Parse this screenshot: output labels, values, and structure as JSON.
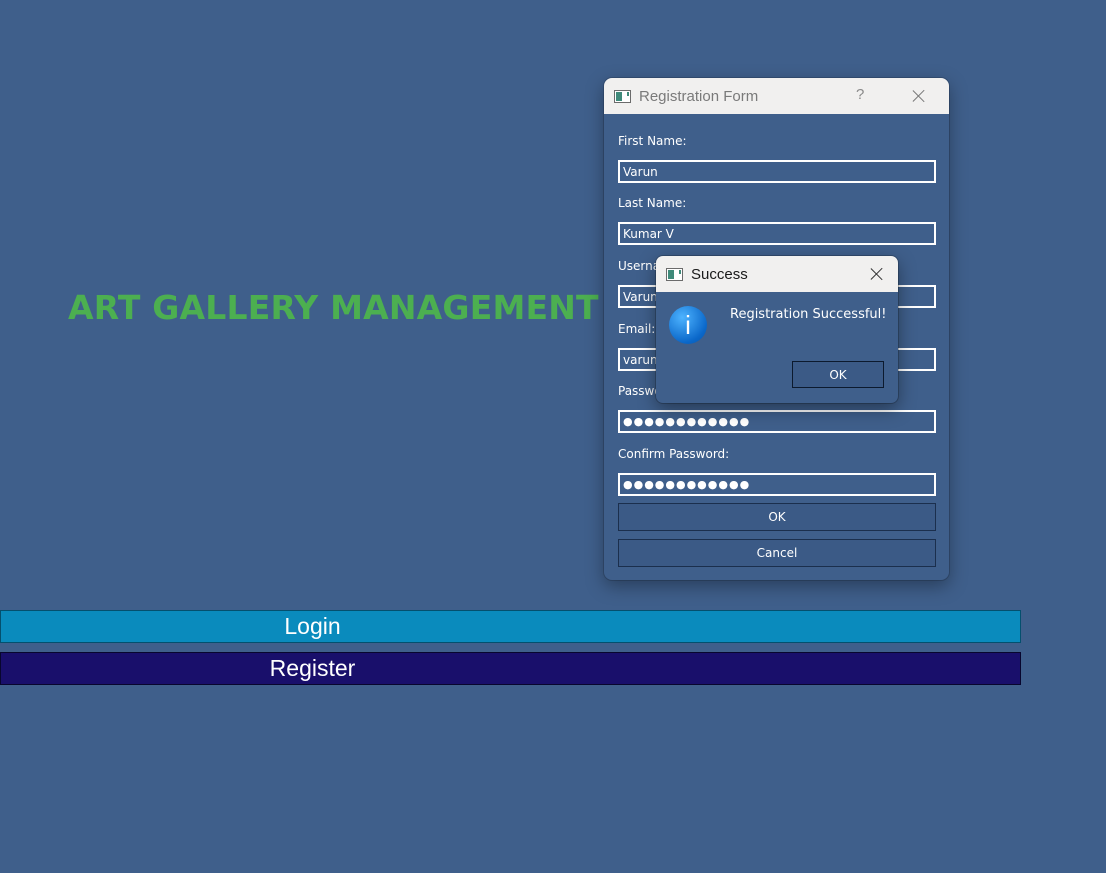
{
  "app": {
    "title": "ART GALLERY MANAGEMENT",
    "login_label": "Login",
    "register_label": "Register"
  },
  "registration_dialog": {
    "title": "Registration Form",
    "help_label": "?",
    "fields": [
      {
        "label": "First Name:",
        "value": "Varun"
      },
      {
        "label": "Last Name:",
        "value": "Kumar V"
      },
      {
        "label": "Username:",
        "value": "Varun"
      },
      {
        "label": "Email:",
        "value": "varunk"
      },
      {
        "label": "Password:",
        "value": "●●●●●●●●●●●●"
      },
      {
        "label": "Confirm Password:",
        "value": "●●●●●●●●●●●●"
      }
    ],
    "ok_label": "OK",
    "cancel_label": "Cancel"
  },
  "success_dialog": {
    "title": "Success",
    "icon": "info-icon",
    "icon_glyph": "i",
    "message": "Registration Successful!",
    "ok_label": "OK"
  },
  "colors": {
    "background": "#3f5f8b",
    "title_green": "#4caf50",
    "login_button": "#0a8bbd",
    "register_button": "#190f6b"
  }
}
